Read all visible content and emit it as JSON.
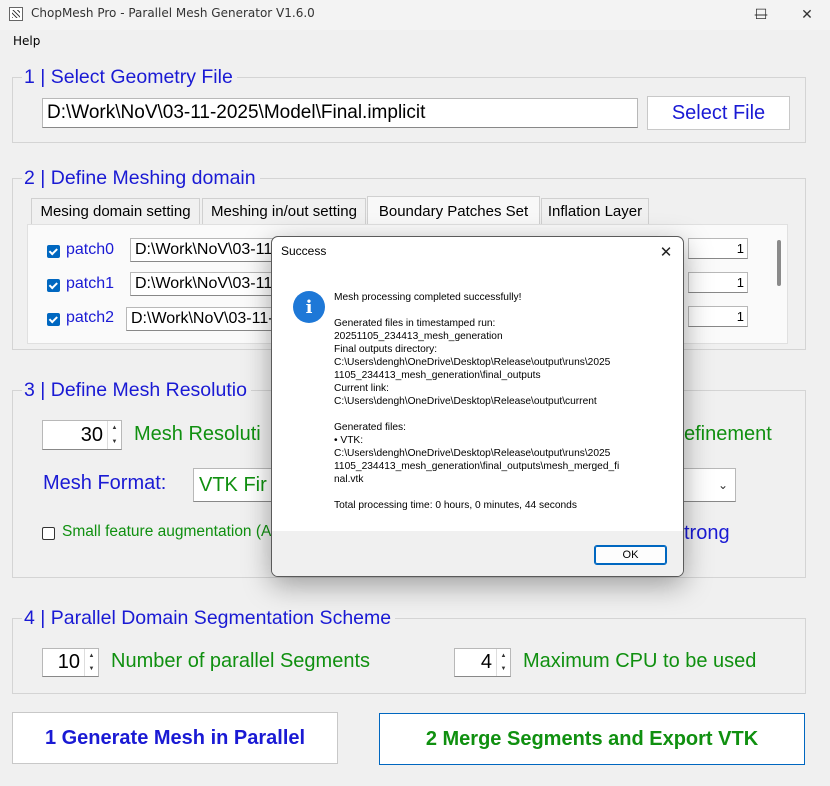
{
  "window": {
    "title": "ChopMesh Pro - Parallel Mesh Generator V1.6.0",
    "minimize": "—",
    "maximize": "☐",
    "close": "✕"
  },
  "menu": {
    "help": "Help"
  },
  "section1": {
    "title": "1 | Select Geometry File",
    "file_path": "D:\\Work\\NoV\\03-11-2025\\Model\\Final.implicit",
    "select_button": "Select File"
  },
  "section2": {
    "title": "2 | Define Meshing domain",
    "tabs": [
      "Mesing domain setting",
      "Meshing in/out setting",
      "Boundary Patches Set",
      "Inflation Layer"
    ],
    "active_tab": "Boundary Patches Set",
    "patches": [
      {
        "name": "patch0",
        "path": "D:\\Work\\NoV\\03-11",
        "value": "1",
        "checked": true
      },
      {
        "name": "patch1",
        "path": "D:\\Work\\NoV\\03-11",
        "value": "1",
        "checked": true
      },
      {
        "name": "patch2",
        "path": "D:\\Work\\NoV\\03-11-",
        "value": "1",
        "checked": true
      }
    ]
  },
  "section3": {
    "title": "3 | Define Mesh Resolutio",
    "resolution_value": "30",
    "resolution_label": "Mesh Resoluti",
    "refinement_label": "efinement",
    "format_label": "Mesh Format:",
    "format_value": "VTK Fir",
    "small_feature_label": "Small feature augmentation (A",
    "strong_label": "trong"
  },
  "section4": {
    "title": "4 | Parallel Domain Segmentation Scheme",
    "segments_value": "10",
    "segments_label": "Number of parallel Segments",
    "cpu_value": "4",
    "cpu_label": "Maximum CPU to be used"
  },
  "actions": {
    "generate": "1 Generate Mesh in Parallel",
    "merge": "2 Merge Segments and Export VTK"
  },
  "dialog": {
    "title": "Success",
    "close": "✕",
    "icon": "i",
    "lines": [
      "Mesh processing completed successfully!",
      "",
      "Generated files in timestamped run:",
      "20251105_234413_mesh_generation",
      "Final outputs directory:",
      "C:\\Users\\dengh\\OneDrive\\Desktop\\Release\\output\\runs\\2025",
      "1105_234413_mesh_generation\\final_outputs",
      "Current link:",
      "C:\\Users\\dengh\\OneDrive\\Desktop\\Release\\output\\current",
      "",
      "Generated files:",
      "• VTK:",
      "C:\\Users\\dengh\\OneDrive\\Desktop\\Release\\output\\runs\\2025",
      "1105_234413_mesh_generation\\final_outputs\\mesh_merged_fi",
      "nal.vtk",
      "",
      "Total processing time: 0 hours, 0 minutes, 44 seconds"
    ],
    "ok": "OK"
  },
  "colors": {
    "section_title": "#1a1ad4",
    "label_green": "#109010",
    "accent": "#0067c0"
  }
}
